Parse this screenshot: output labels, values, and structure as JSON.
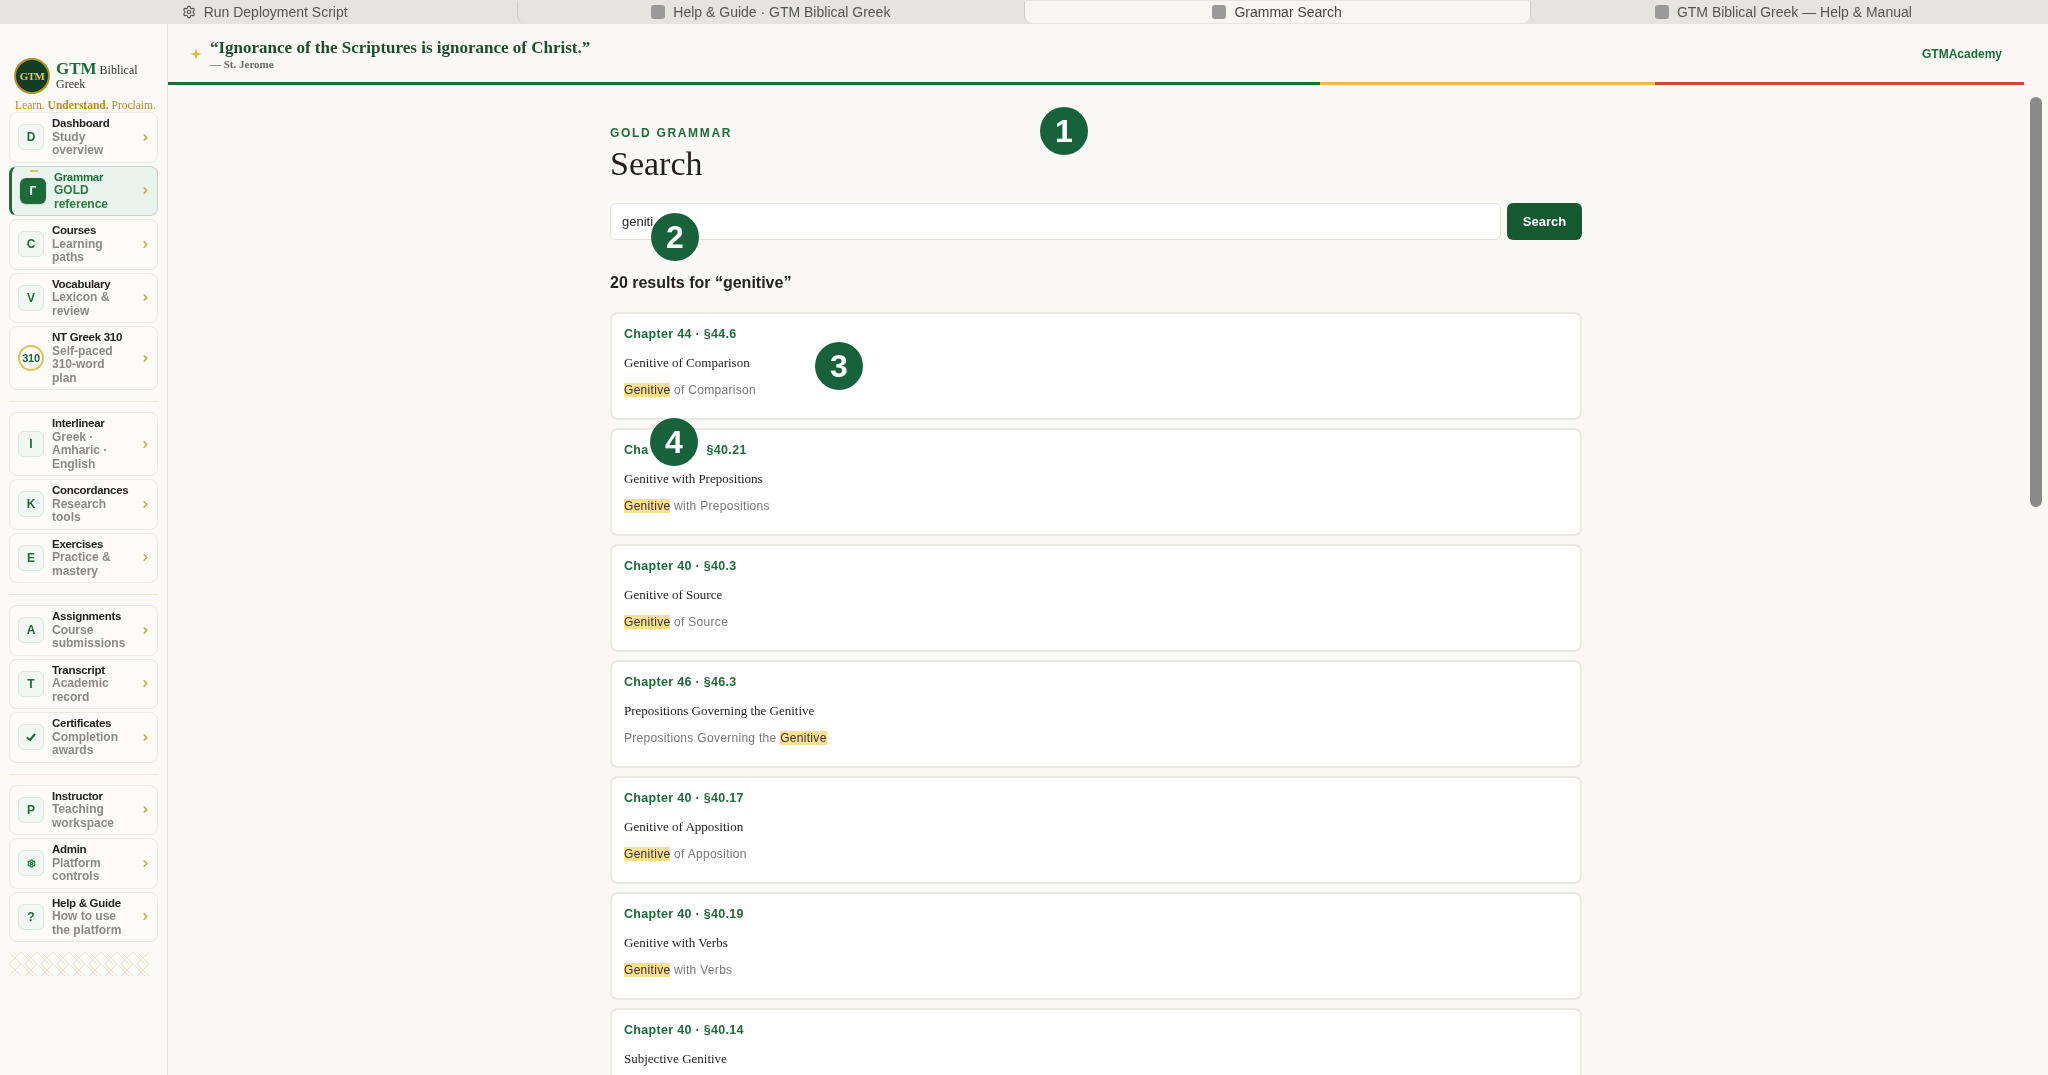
{
  "browser_tabs": [
    {
      "label": "Run Deployment Script",
      "selected": false,
      "kind": "gear"
    },
    {
      "label": "Help & Guide · GTM Biblical Greek",
      "selected": false,
      "kind": "site"
    },
    {
      "label": "Grammar Search",
      "selected": true,
      "kind": "site"
    },
    {
      "label": "GTM Biblical Greek — Help & Manual",
      "selected": false,
      "kind": "site"
    }
  ],
  "brand": {
    "logo": "GTM",
    "name": "GTM",
    "name_rest": "Biblical Greek",
    "tagline_parts": [
      "Learn.",
      "Understand.",
      "Proclaim."
    ]
  },
  "sidebar": {
    "groups": [
      [
        {
          "badge": "D",
          "kind": "letter",
          "title": "Dashboard",
          "subtitle": "Study overview",
          "selected": false
        },
        {
          "badge": "Г",
          "kind": "letter",
          "title": "Grammar",
          "subtitle": "GOLD reference",
          "selected": true
        },
        {
          "badge": "C",
          "kind": "letter",
          "title": "Courses",
          "subtitle": "Learning paths",
          "selected": false
        },
        {
          "badge": "V",
          "kind": "letter",
          "title": "Vocabulary",
          "subtitle": "Lexicon & review",
          "selected": false
        },
        {
          "badge": "310",
          "kind": "ring",
          "title": "NT Greek 310",
          "subtitle": "Self-paced 310-word plan",
          "selected": false
        }
      ],
      [
        {
          "badge": "I",
          "kind": "letter",
          "title": "Interlinear",
          "subtitle": "Greek · Amharic · English",
          "selected": false
        },
        {
          "badge": "K",
          "kind": "letter",
          "title": "Concordances",
          "subtitle": "Research tools",
          "selected": false
        },
        {
          "badge": "E",
          "kind": "letter",
          "title": "Exercises",
          "subtitle": "Practice & mastery",
          "selected": false
        }
      ],
      [
        {
          "badge": "A",
          "kind": "letter",
          "title": "Assignments",
          "subtitle": "Course submissions",
          "selected": false
        },
        {
          "badge": "T",
          "kind": "letter",
          "title": "Transcript",
          "subtitle": "Academic record",
          "selected": false
        },
        {
          "kind": "check",
          "title": "Certificates",
          "subtitle": "Completion awards",
          "selected": false
        }
      ],
      [
        {
          "badge": "P",
          "kind": "letter",
          "title": "Instructor",
          "subtitle": "Teaching workspace",
          "selected": false
        },
        {
          "kind": "dot",
          "title": "Admin",
          "subtitle": "Platform controls",
          "selected": false
        },
        {
          "badge": "?",
          "kind": "letter",
          "title": "Help & Guide",
          "subtitle": "How to use the platform",
          "selected": false
        }
      ]
    ]
  },
  "quote": {
    "text": "“Ignorance of the Scriptures is ignorance of Christ.”",
    "source": "— St. Jerome"
  },
  "account": "GTMAcademy",
  "page": {
    "eyebrow": "GOLD GRAMMAR",
    "title": "Search"
  },
  "search": {
    "value": "geniti",
    "button": "Search"
  },
  "results_summary": "20 results for “genitive”",
  "results": [
    {
      "heading": "Chapter 44 · §44.6",
      "title": "Genitive of Comparison",
      "snippet": [
        {
          "text": "Genitive",
          "highlight": true
        },
        {
          "text": " of Comparison",
          "highlight": false
        }
      ]
    },
    {
      "heading": "Cha",
      "heading_after": "§40.21",
      "title": "Genitive with Prepositions",
      "snippet": [
        {
          "text": "Genitive",
          "highlight": true
        },
        {
          "text": " with Prepositions",
          "highlight": false
        }
      ]
    },
    {
      "heading": "Chapter 40 · §40.3",
      "title": "Genitive of Source",
      "snippet": [
        {
          "text": "Genitive",
          "highlight": true
        },
        {
          "text": " of Source",
          "highlight": false
        }
      ]
    },
    {
      "heading": "Chapter 46 · §46.3",
      "title": "Prepositions Governing the Genitive",
      "snippet": [
        {
          "text": "Prepositions Governing the ",
          "highlight": false
        },
        {
          "text": "Genitive",
          "highlight": true
        }
      ]
    },
    {
      "heading": "Chapter 40 · §40.17",
      "title": "Genitive of Apposition",
      "snippet": [
        {
          "text": "Genitive",
          "highlight": true
        },
        {
          "text": " of Apposition",
          "highlight": false
        }
      ]
    },
    {
      "heading": "Chapter 40 · §40.19",
      "title": "Genitive with Verbs",
      "snippet": [
        {
          "text": "Genitive",
          "highlight": true
        },
        {
          "text": " with Verbs",
          "highlight": false
        }
      ]
    },
    {
      "heading": "Chapter 40 · §40.14",
      "title": "Subjective Genitive"
    }
  ],
  "annotations": [
    "1",
    "2",
    "3",
    "4"
  ]
}
